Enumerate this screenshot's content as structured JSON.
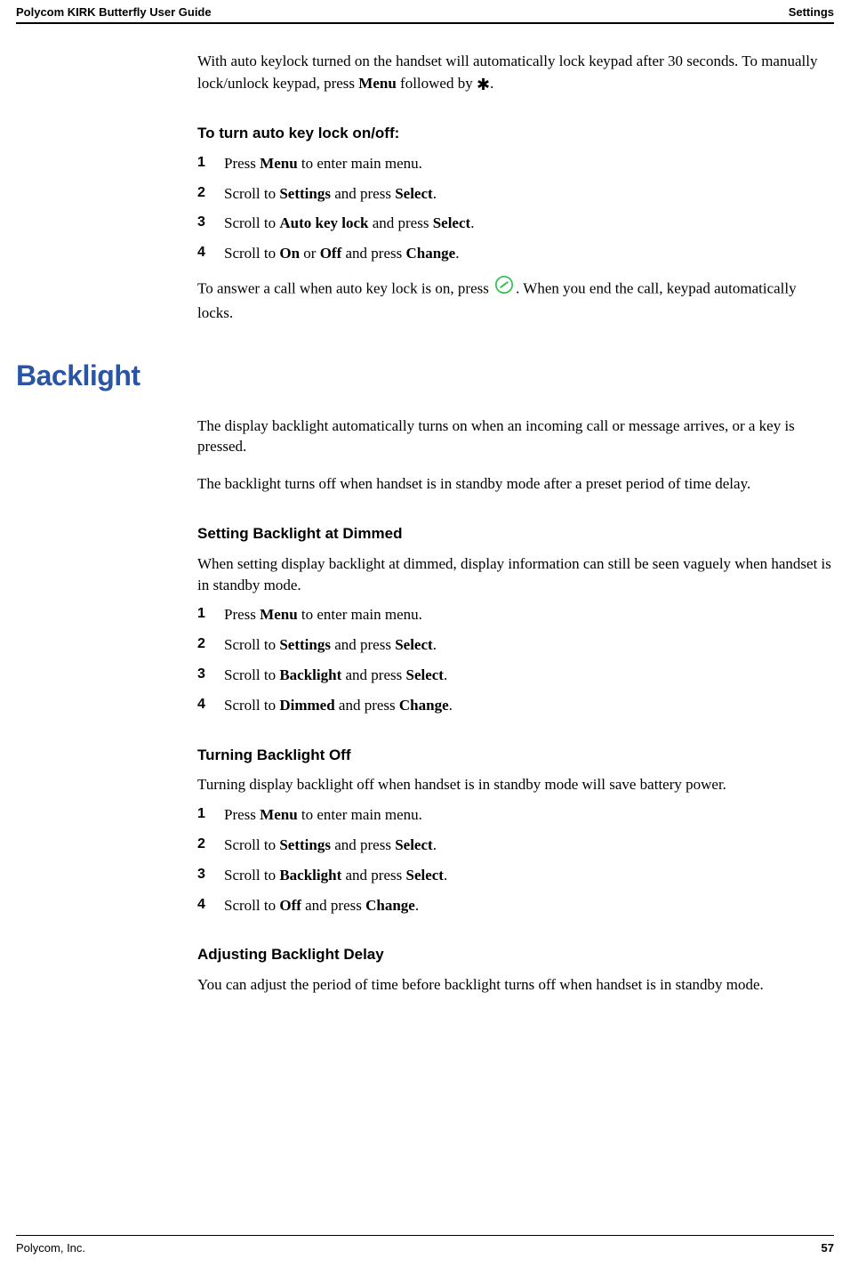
{
  "header": {
    "left": "Polycom KIRK Butterfly User Guide",
    "right": "Settings"
  },
  "intro": {
    "line1_a": "With auto keylock turned on the handset will automatically lock keypad after 30 seconds. To manually lock/unlock keypad, press ",
    "line1_b": "Menu",
    "line1_c": " followed by ",
    "star": "✱",
    "line1_d": "."
  },
  "s1": {
    "heading": "To turn auto key lock on/off:",
    "steps": [
      {
        "a": "Press ",
        "b": "Menu",
        "c": " to enter main menu."
      },
      {
        "a": "Scroll to ",
        "b": "Settings",
        "c": " and press ",
        "d": "Select",
        "e": "."
      },
      {
        "a": "Scroll to ",
        "b": "Auto key lock",
        "c": " and press ",
        "d": "Select",
        "e": "."
      },
      {
        "a": "Scroll to ",
        "b": "On",
        "c": " or ",
        "d": "Off",
        "e": " and press ",
        "f": "Change",
        "g": "."
      }
    ],
    "post_a": "To answer a call when auto key lock is on, press ",
    "post_b": ". When you end the call, keypad automatically locks."
  },
  "h2": "Backlight",
  "bk_intro1": "The display backlight automatically turns on when an incoming call or message arrives, or a key is pressed.",
  "bk_intro2": "The backlight turns off when handset is in standby mode after a preset period of time delay.",
  "s2": {
    "heading": "Setting Backlight at Dimmed",
    "intro": "When setting display backlight at dimmed, display information can still be seen vaguely when handset is in standby mode.",
    "steps": [
      {
        "a": "Press ",
        "b": "Menu",
        "c": " to enter main menu."
      },
      {
        "a": "Scroll to ",
        "b": "Settings",
        "c": " and press ",
        "d": "Select",
        "e": "."
      },
      {
        "a": "Scroll to ",
        "b": "Backlight",
        "c": " and press ",
        "d": "Select",
        "e": "."
      },
      {
        "a": "Scroll to ",
        "b": "Dimmed",
        "c": " and press ",
        "d": "Change",
        "e": "."
      }
    ]
  },
  "s3": {
    "heading": "Turning Backlight Off",
    "intro": "Turning display backlight off when handset is in standby mode will save battery power.",
    "steps": [
      {
        "a": "Press ",
        "b": "Menu",
        "c": " to enter main menu."
      },
      {
        "a": "Scroll to ",
        "b": "Settings",
        "c": " and press ",
        "d": "Select",
        "e": "."
      },
      {
        "a": "Scroll to ",
        "b": "Backlight",
        "c": " and press ",
        "d": "Select",
        "e": "."
      },
      {
        "a": "Scroll to ",
        "b": "Off",
        "c": " and press ",
        "d": "Change",
        "e": "."
      }
    ]
  },
  "s4": {
    "heading": "Adjusting Backlight Delay",
    "intro": "You can adjust the period of time before backlight turns off when handset is in standby mode."
  },
  "footer": {
    "left": "Polycom, Inc.",
    "right": "57"
  }
}
